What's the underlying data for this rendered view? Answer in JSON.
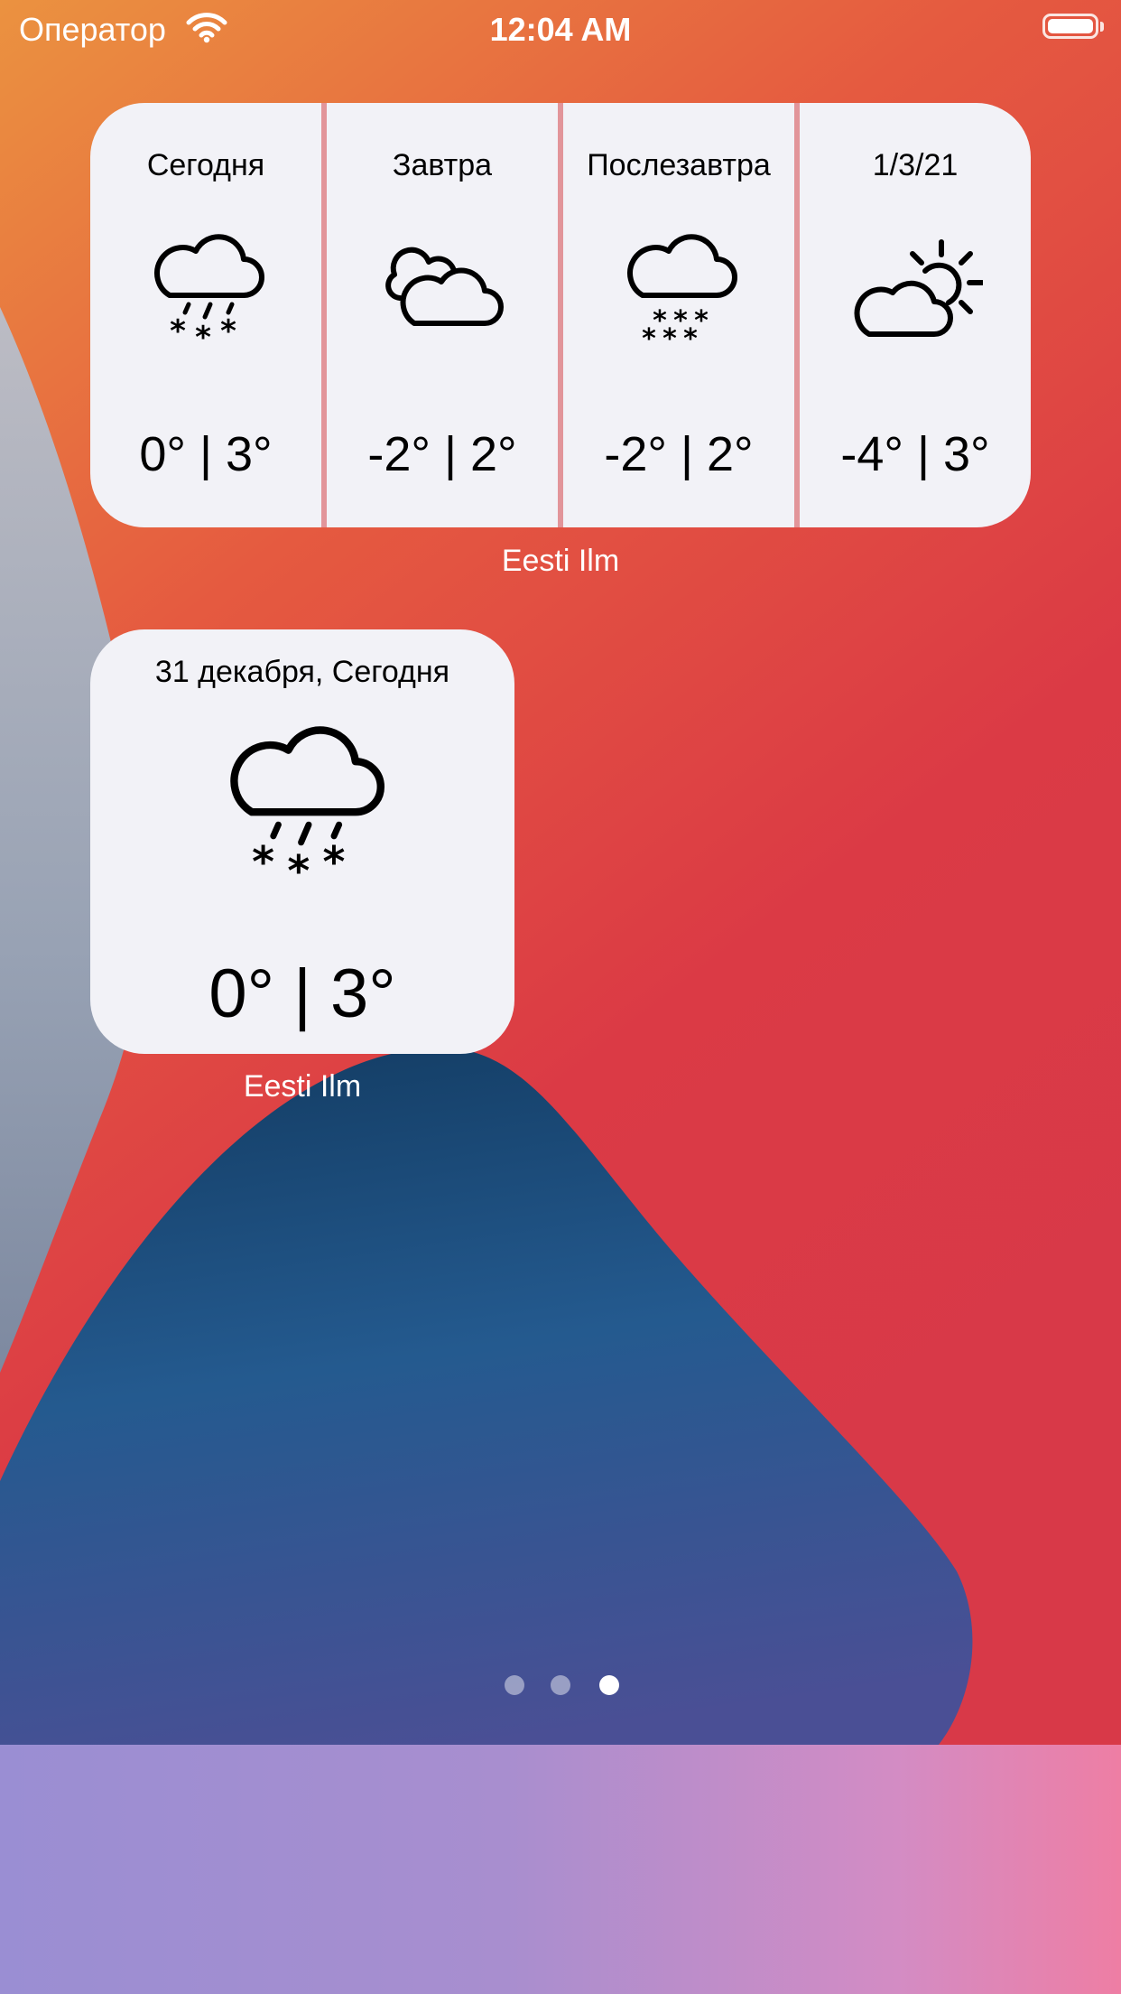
{
  "status_bar": {
    "carrier": "Оператор",
    "time": "12:04 AM",
    "wifi_icon": "wifi-icon",
    "battery_icon": "battery-full-icon",
    "battery_level": 1.0
  },
  "widgets": {
    "forecast": {
      "app_name": "Eesti Ilm",
      "divider_color": "#e2959a",
      "days": [
        {
          "label": "Сегодня",
          "temps": "0° | 3°",
          "icon": "cloud-rain-snow-icon"
        },
        {
          "label": "Завтра",
          "temps": "-2° | 2°",
          "icon": "clouds-icon"
        },
        {
          "label": "Послезавтра",
          "temps": "-2° | 2°",
          "icon": "cloud-snow-icon"
        },
        {
          "label": "1/3/21",
          "temps": "-4° | 3°",
          "icon": "cloud-sun-icon"
        }
      ]
    },
    "today": {
      "app_name": "Eesti Ilm",
      "date_label": "31 декабря, Сегодня",
      "temps": "0° | 3°",
      "icon": "cloud-rain-snow-icon"
    }
  },
  "page_indicator": {
    "pages": 3,
    "current": 3
  },
  "colors": {
    "widget_background": "#f2f2f7",
    "wallpaper_orange": "#e98e3f",
    "wallpaper_red": "#db3a45",
    "wallpaper_blue": "#1d4f7d",
    "wallpaper_gray": "#a3aabc"
  }
}
